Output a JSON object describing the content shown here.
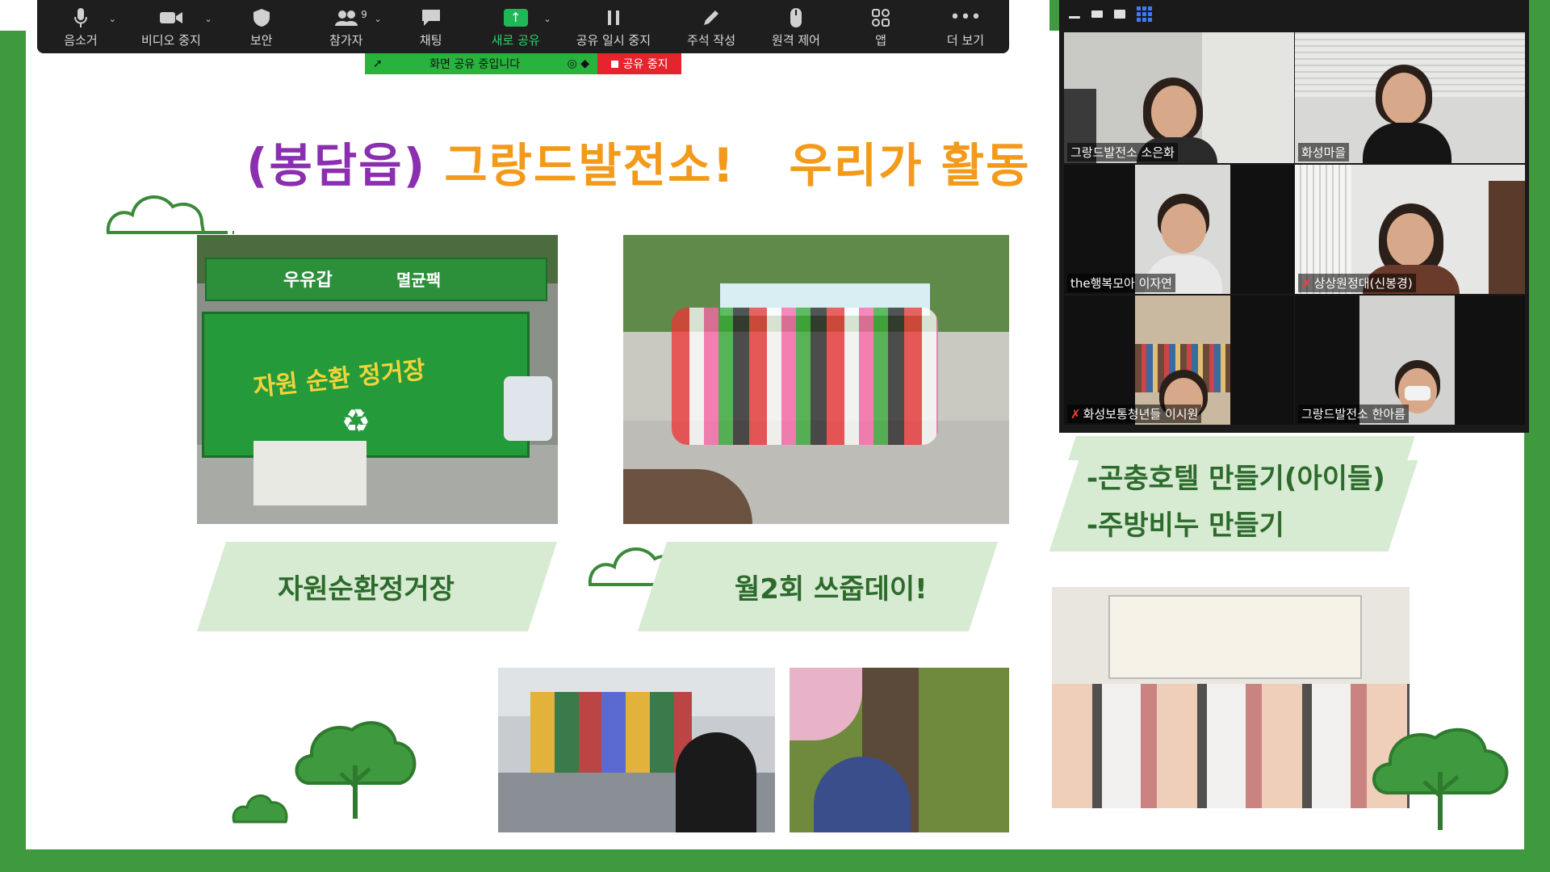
{
  "toolbar": {
    "items": [
      {
        "label": "음소거",
        "icon": "microphone-icon"
      },
      {
        "label": "비디오 중지",
        "icon": "video-camera-icon"
      },
      {
        "label": "보안",
        "icon": "shield-icon"
      },
      {
        "label": "참가자",
        "icon": "participants-icon",
        "badge": "9"
      },
      {
        "label": "채팅",
        "icon": "chat-icon"
      },
      {
        "label": "새로 공유",
        "icon": "share-screen-icon"
      },
      {
        "label": "공유 일시 중지",
        "icon": "pause-icon"
      },
      {
        "label": "주석 작성",
        "icon": "pencil-icon"
      },
      {
        "label": "원격 제어",
        "icon": "mouse-icon"
      },
      {
        "label": "앱",
        "icon": "apps-icon"
      },
      {
        "label": "더 보기",
        "icon": "more-icon"
      }
    ]
  },
  "sharebar": {
    "status": "화면 공유 중입니다",
    "stop": "공유 중지"
  },
  "slide": {
    "title_part1": "(봉담읍)",
    "title_part2": "그랑드발전소!",
    "title_part3": "우리가 활동",
    "label1": "자원순환정거장",
    "label2": "월2회 쓰줍데이!",
    "list": [
      "-곤충호텔 만들기(아이들)",
      "-주방비누 만들기"
    ],
    "photo1_text": [
      "우유갑",
      "멸균팩",
      "자원 순환 정거장"
    ]
  },
  "gallery": {
    "participants": [
      {
        "name": "그랑드발전소 소은화",
        "muted": false,
        "active": true
      },
      {
        "name": "화성마을",
        "muted": false,
        "active": false
      },
      {
        "name": "the행복모아 이자연",
        "muted": false,
        "active": false
      },
      {
        "name": "상상원정대(신봉경)",
        "muted": true,
        "active": false
      },
      {
        "name": "화성보통청년들 이시원",
        "muted": true,
        "active": false
      },
      {
        "name": "그랑드발전소 한아름",
        "muted": false,
        "active": false
      }
    ]
  },
  "colors": {
    "green": "#3f9a3f",
    "purple": "#8b2fb0",
    "orange": "#f39a1b",
    "label_bg": "#d7ead2",
    "label_text": "#2c6b2c",
    "share_green": "#27b33d",
    "stop_red": "#e6242d"
  }
}
